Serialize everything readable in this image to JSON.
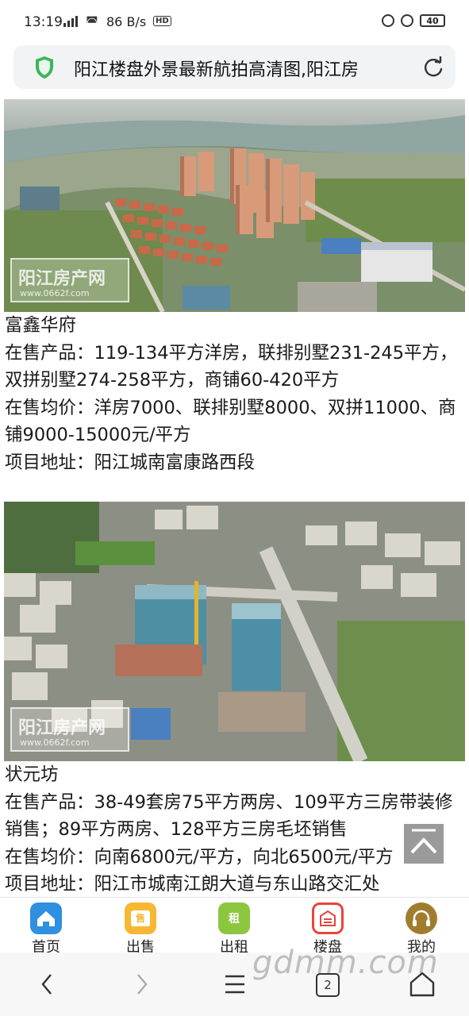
{
  "status_bar": {
    "time": "13:19",
    "network": "4G",
    "speed": "86 B/s",
    "hd": "HD",
    "battery": "40"
  },
  "address_bar": {
    "title": "阳江楼盘外景最新航拍高清图,阳江房",
    "shield_color": "#3cb55a"
  },
  "watermark": {
    "name": "阳江房产网",
    "url": "www.0662f.com"
  },
  "listings": [
    {
      "name": "富鑫华府",
      "products": "在售产品：119-134平方洋房，联排别墅231-245平方，双拼别墅274-258平方，商铺60-420平方",
      "price": "在售均价：洋房7000、联排别墅8000、双拼11000、商铺9000-15000元/平方",
      "address": "项目地址：阳江城南富康路西段"
    },
    {
      "name": "状元坊",
      "products": "在售产品：38-49套房75平方两房、109平方三房带装修销售；89平方两房、128平方三房毛坯销售",
      "price": "在售均价：向南6800元/平方，向北6500元/平方",
      "address": "项目地址：阳江市城南江朗大道与东山路交汇处"
    }
  ],
  "tabbar": [
    {
      "label": "首页",
      "icon": "home-icon",
      "color": "#2f8fe0"
    },
    {
      "label": "出售",
      "icon": "sale-icon",
      "color": "#f7b733",
      "glyph": "售"
    },
    {
      "label": "出租",
      "icon": "rent-icon",
      "color": "#8cc63f",
      "glyph": "租"
    },
    {
      "label": "楼盘",
      "icon": "building-icon",
      "color": "#e8453c"
    },
    {
      "label": "我的",
      "icon": "headset-icon",
      "color": "#a07d2e"
    }
  ],
  "navbar": {
    "tab_count": "2"
  },
  "site_watermark": "gdmm.com"
}
